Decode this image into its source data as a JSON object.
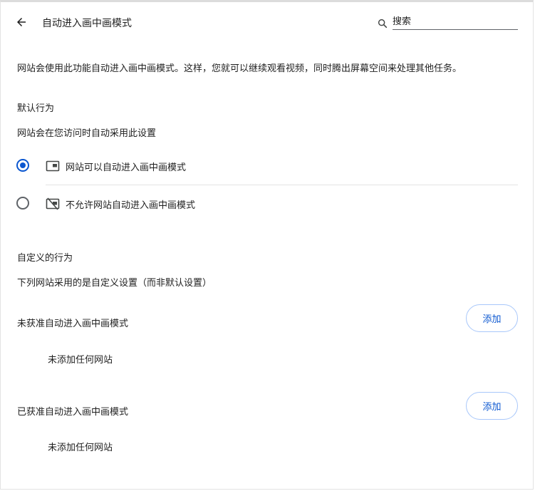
{
  "header": {
    "title": "自动进入画中画模式",
    "search_placeholder": "搜索",
    "back_icon": "arrow-back-icon",
    "search_icon": "search-icon"
  },
  "description": "网站会使用此功能自动进入画中画模式。这样，您就可以继续观看视频，同时腾出屏幕空间来处理其他任务。",
  "default_behavior": {
    "heading": "默认行为",
    "subheading": "网站会在您访问时自动采用此设置",
    "options": [
      {
        "label": "网站可以自动进入画中画模式",
        "selected": true,
        "icon": "picture-in-picture-icon"
      },
      {
        "label": "不允许网站自动进入画中画模式",
        "selected": false,
        "icon": "picture-in-picture-off-icon"
      }
    ]
  },
  "custom_behavior": {
    "heading": "自定义的行为",
    "subheading": "下列网站采用的是自定义设置（而非默认设置）",
    "sections": [
      {
        "title": "未获准自动进入画中画模式",
        "add_label": "添加",
        "empty_text": "未添加任何网站"
      },
      {
        "title": "已获准自动进入画中画模式",
        "add_label": "添加",
        "empty_text": "未添加任何网站"
      }
    ]
  },
  "colors": {
    "accent": "#0b57d0",
    "button_border": "#a8c7fa",
    "text": "#1f1f1f",
    "divider": "#e3e3e3"
  }
}
